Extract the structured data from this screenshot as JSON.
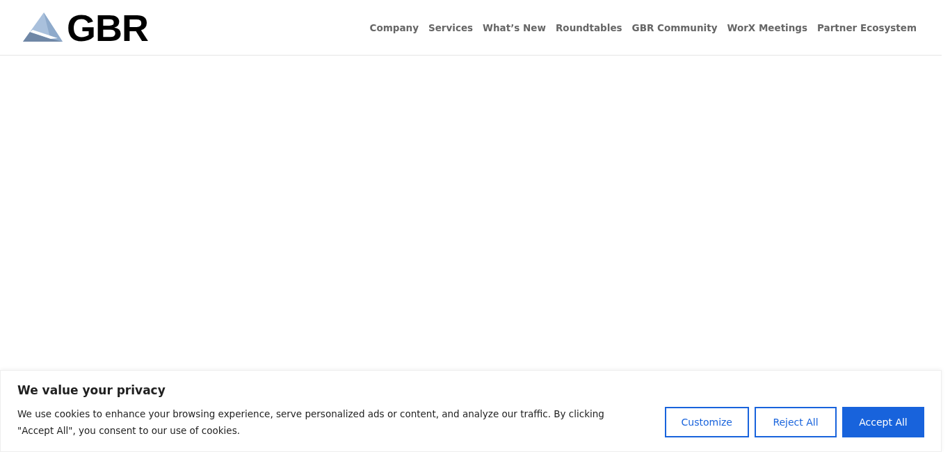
{
  "header": {
    "logo_text": "GBR",
    "nav": [
      {
        "label": "Company"
      },
      {
        "label": "Services"
      },
      {
        "label": "What’s New"
      },
      {
        "label": "Roundtables"
      },
      {
        "label": "GBR Community"
      },
      {
        "label": "WorX Meetings"
      },
      {
        "label": "Partner Ecosystem"
      }
    ]
  },
  "cookie_banner": {
    "title": "We value your privacy",
    "text": "We use cookies to enhance your browsing experience, serve personalized ads or content, and analyze our traffic. By clicking \"Accept All\", you consent to our use of cookies.",
    "buttons": [
      {
        "label": "Customize",
        "kind": "outline"
      },
      {
        "label": "Reject All",
        "kind": "outline"
      },
      {
        "label": "Accept All",
        "kind": "filled"
      }
    ]
  }
}
